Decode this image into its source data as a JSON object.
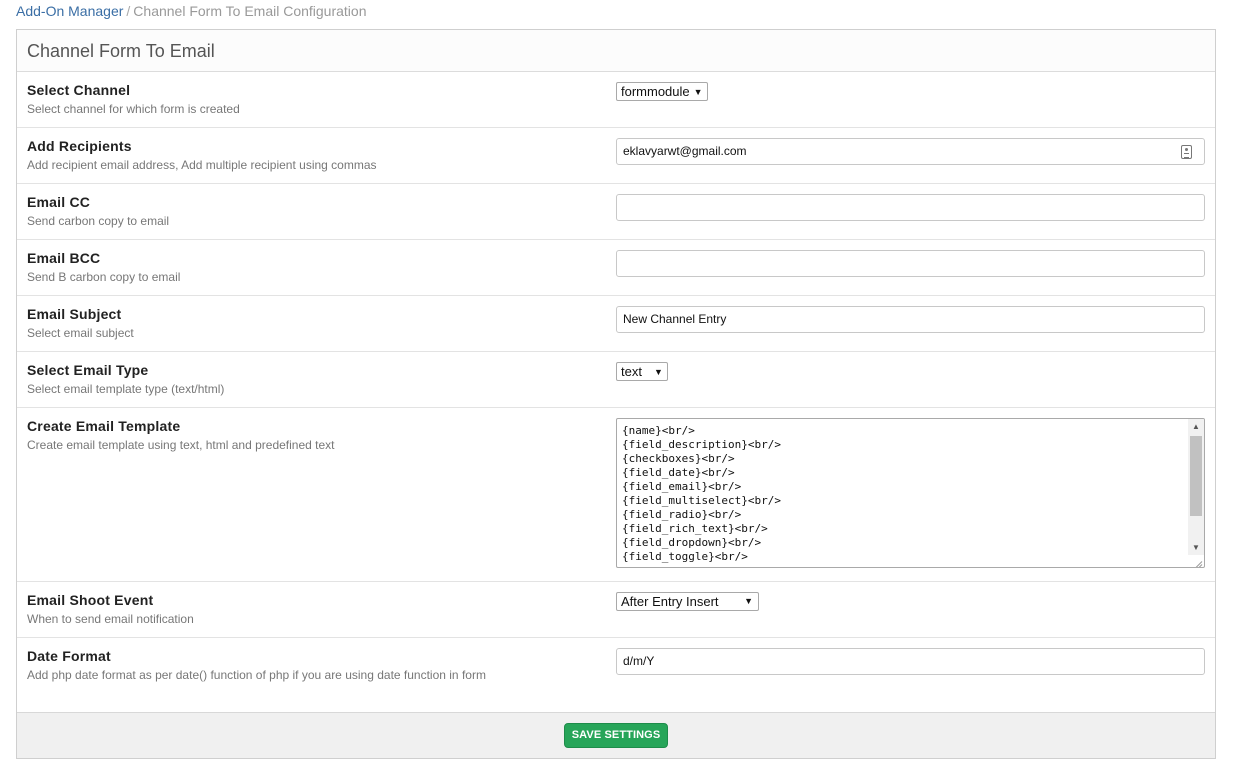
{
  "breadcrumb": {
    "parent": "Add-On Manager",
    "separator": "/",
    "current": "Channel Form To Email Configuration"
  },
  "panel": {
    "title": "Channel Form To Email"
  },
  "fields": {
    "select_channel": {
      "label": "Select Channel",
      "desc": "Select channel for which form is created",
      "value": "formmodule"
    },
    "add_recipients": {
      "label": "Add Recipients",
      "desc": "Add recipient email address, Add multiple recipient using commas",
      "value": "eklavyarwt@gmail.com"
    },
    "email_cc": {
      "label": "Email CC",
      "desc": "Send carbon copy to email",
      "value": ""
    },
    "email_bcc": {
      "label": "Email BCC",
      "desc": "Send B carbon copy to email",
      "value": ""
    },
    "email_subject": {
      "label": "Email Subject",
      "desc": "Select email subject",
      "value": "New Channel Entry"
    },
    "email_type": {
      "label": "Select Email Type",
      "desc": "Select email template type (text/html)",
      "value": "text"
    },
    "email_template": {
      "label": "Create Email Template",
      "desc": "Create email template using text, html and predefined text",
      "lines": [
        "{name}<br/>",
        "{field_description}<br/>",
        "{checkboxes}<br/>",
        "{field_date}<br/>",
        "{field_email}<br/>",
        "{field_multiselect}<br/>",
        "{field_radio}<br/>",
        "{field_rich_text}<br/>",
        "{field_dropdown}<br/>",
        "{field_toggle}<br/>"
      ]
    },
    "shoot_event": {
      "label": "Email Shoot Event",
      "desc": "When to send email notification",
      "value": "After Entry Insert"
    },
    "date_format": {
      "label": "Date Format",
      "desc": "Add php date format as per date() function of php if you are using date function in form",
      "value": "d/m/Y"
    }
  },
  "footer": {
    "save_label": "SAVE SETTINGS"
  },
  "colors": {
    "link": "#3a6ea5",
    "save_button": "#27a559"
  }
}
